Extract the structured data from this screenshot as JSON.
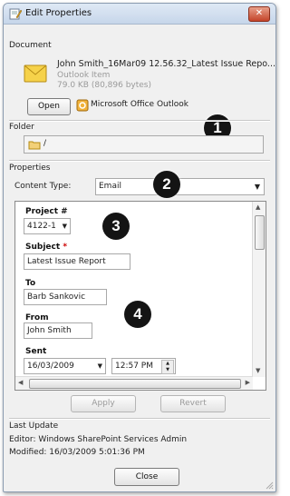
{
  "window": {
    "title": "Edit Properties",
    "close_glyph": "✕"
  },
  "document": {
    "section_label": "Document",
    "filename": "John Smith_16Mar09 12.56.32_Latest Issue Repo...",
    "item_type": "Outlook Item",
    "size": "79.0 KB (80,896 bytes)",
    "open_label": "Open",
    "app_name": "Microsoft Office Outlook"
  },
  "folder": {
    "section_label": "Folder",
    "path": "/"
  },
  "properties": {
    "section_label": "Properties",
    "content_type_label": "Content Type:",
    "content_type_value": "Email"
  },
  "form": {
    "project_label": "Project #",
    "project_value": "4122-1",
    "subject_label": "Subject",
    "required_mark": "*",
    "subject_value": "Latest Issue Report",
    "to_label": "To",
    "to_value": "Barb Sankovic",
    "from_label": "From",
    "from_value": "John Smith",
    "sent_label": "Sent",
    "sent_date": "16/03/2009",
    "sent_time": "12:57 PM"
  },
  "actions": {
    "apply_label": "Apply",
    "revert_label": "Revert"
  },
  "last_update": {
    "section_label": "Last Update",
    "editor_line": "Editor: Windows SharePoint Services Admin",
    "modified_line": "Modified: 16/03/2009 5:01:36 PM"
  },
  "close_label": "Close",
  "callouts": [
    "1",
    "2",
    "3",
    "4"
  ],
  "colors": {
    "accent_badge": "#141414",
    "required": "#cc0000",
    "close_button": "#c4442a"
  }
}
